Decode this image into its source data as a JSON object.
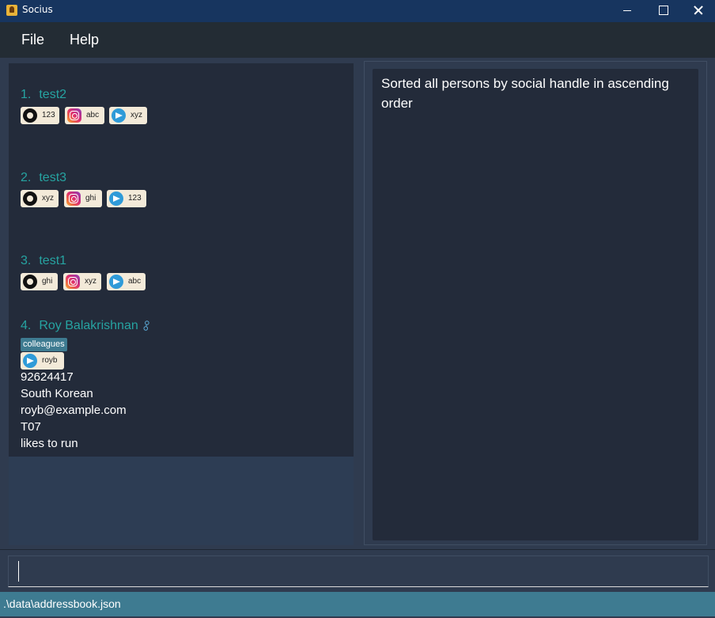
{
  "window": {
    "title": "Socius"
  },
  "menu": {
    "file": "File",
    "help": "Help"
  },
  "persons": [
    {
      "index": "1.",
      "name": "test2",
      "socials": [
        {
          "icon": "github-icon",
          "handle": "123"
        },
        {
          "icon": "instagram-icon",
          "handle": "abc"
        },
        {
          "icon": "telegram-icon",
          "handle": "xyz"
        }
      ]
    },
    {
      "index": "2.",
      "name": "test3",
      "socials": [
        {
          "icon": "github-icon",
          "handle": "xyz"
        },
        {
          "icon": "instagram-icon",
          "handle": "ghi"
        },
        {
          "icon": "telegram-icon",
          "handle": "123"
        }
      ]
    },
    {
      "index": "3.",
      "name": "test1",
      "socials": [
        {
          "icon": "github-icon",
          "handle": "ghi"
        },
        {
          "icon": "instagram-icon",
          "handle": "xyz"
        },
        {
          "icon": "telegram-icon",
          "handle": "abc"
        }
      ]
    },
    {
      "index": "4.",
      "name": "Roy Balakrishnan",
      "name_icon": "link-icon",
      "tag": "colleagues",
      "socials": [
        {
          "icon": "telegram-icon",
          "handle": "royb"
        }
      ],
      "phone": "92624417",
      "nationality": "South Korean",
      "email": "royb@example.com",
      "tutorial": "T07",
      "remark": "likes to run"
    }
  ],
  "result": {
    "message": "Sorted all persons by social handle in ascending order"
  },
  "command": {
    "value": ""
  },
  "status": {
    "path": ".\\data\\addressbook.json"
  },
  "colors": {
    "accent": "#26a3a1",
    "status_bar": "#3e7b91",
    "title_bar": "#17355f",
    "card": "#232b3a"
  }
}
